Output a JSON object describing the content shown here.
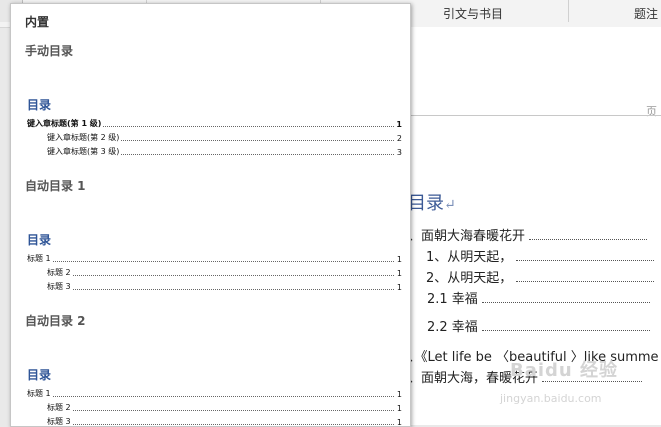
{
  "ribbon": {
    "tabs": [
      "引文与书目",
      "题注"
    ]
  },
  "gallery": {
    "section_title": "内置",
    "items": [
      {
        "name": "手动目录",
        "heading": "目录",
        "entries": [
          {
            "label": "键入章标题(第 1 级)",
            "page": "1",
            "level": 1
          },
          {
            "label": "键入章标题(第 2 级)",
            "page": "2",
            "level": 2
          },
          {
            "label": "键入章标题(第 3 级)",
            "page": "3",
            "level": 3
          }
        ]
      },
      {
        "name": "自动目录 1",
        "heading": "目录",
        "entries": [
          {
            "label": "标题 1",
            "page": "1",
            "level": 1
          },
          {
            "label": "标题 2",
            "page": "1",
            "level": 2
          },
          {
            "label": "标题 3",
            "page": "1",
            "level": 3
          }
        ]
      },
      {
        "name": "自动目录 2",
        "heading": "目录",
        "entries": [
          {
            "label": "标题 1",
            "page": "1",
            "level": 1
          },
          {
            "label": "标题 2",
            "page": "1",
            "level": 2
          },
          {
            "label": "标题 3",
            "page": "1",
            "level": 3
          }
        ]
      }
    ]
  },
  "document": {
    "header_char": "页",
    "toc_title": "目录",
    "toc_mark": "↵",
    "lines": [
      "、面朝大海春暖花开",
      "1、从明天起，",
      "2、从明天起，",
      "2.1  幸福",
      "2.2  幸福",
      "、《Let life be  〈beautiful 〉like summe",
      "、面朝大海，春暖花开"
    ]
  },
  "watermark": {
    "text": "Baidu 经验",
    "url": "jingyan.baidu.com"
  }
}
